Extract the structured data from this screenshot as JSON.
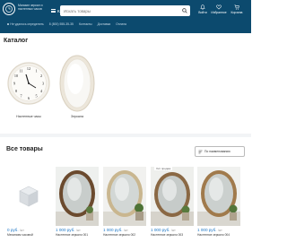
{
  "header": {
    "brand_text": "Магазин зеркал и настенных часов",
    "catalog_label": "Каталог",
    "search_placeholder": "Искать товары",
    "icons": [
      {
        "name": "bell-icon",
        "label": "Войти"
      },
      {
        "name": "heart-icon",
        "label": "Избранное"
      },
      {
        "name": "cart-icon",
        "label": "Корзина"
      }
    ]
  },
  "subbar": {
    "location": "Не удалось определить",
    "phone": "8 (800) 555-35-35",
    "links": [
      "Контакты",
      "Доставка",
      "Оплата"
    ]
  },
  "catalog": {
    "title": "Каталог",
    "items": [
      {
        "label": "Настенные часы",
        "icon": "wall-clock-image"
      },
      {
        "label": "Зеркала",
        "icon": "round-mirror-image"
      }
    ]
  },
  "all_products": {
    "title": "Все товары",
    "sort_label": "По наименованию",
    "products": [
      {
        "price": "0 руб.",
        "unit": "/шт",
        "name": "Механизм часовой",
        "badge": ""
      },
      {
        "price": "1 000 руб.",
        "unit": "/шт",
        "name": "Настенное зеркало 001",
        "badge": ""
      },
      {
        "price": "1 000 руб.",
        "unit": "/шт",
        "name": "Настенное зеркало 002",
        "badge": ""
      },
      {
        "price": "1 000 руб.",
        "unit": "/шт",
        "name": "Настенное зеркало 003",
        "badge": "Хит продаж"
      },
      {
        "price": "1 000 руб.",
        "unit": "/шт",
        "name": "Настенное зеркало 004",
        "badge": ""
      }
    ]
  },
  "colors": {
    "header_bg": "#0c4a6e",
    "price": "#1c76c5"
  }
}
